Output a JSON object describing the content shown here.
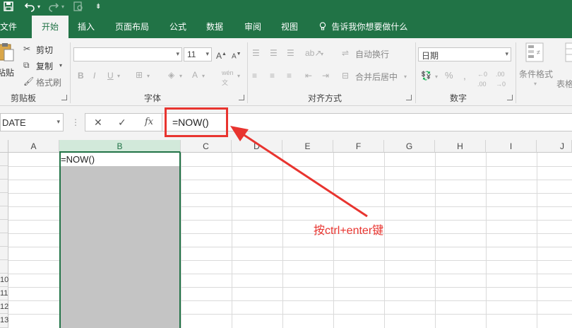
{
  "quick_access": {
    "save_icon": "save-icon",
    "undo_icon": "undo-icon",
    "redo_icon": "redo-icon"
  },
  "tabs": [
    {
      "label": "文件"
    },
    {
      "label": "开始",
      "active": true
    },
    {
      "label": "插入"
    },
    {
      "label": "页面布局"
    },
    {
      "label": "公式"
    },
    {
      "label": "数据"
    },
    {
      "label": "审阅"
    },
    {
      "label": "视图"
    }
  ],
  "tell_me": "告诉我你想要做什么",
  "ribbon": {
    "clipboard": {
      "paste": "粘贴",
      "cut": "剪切",
      "copy": "复制",
      "format_painter": "格式刷",
      "label": "剪贴板"
    },
    "font": {
      "font_name": "",
      "font_size": "11",
      "label": "字体"
    },
    "alignment": {
      "wrap_text": "自动换行",
      "merge_center": "合并后居中",
      "label": "对齐方式"
    },
    "number": {
      "format": "日期",
      "label": "数字"
    },
    "styles": {
      "conditional": "条件格式",
      "table_partial": "表格"
    }
  },
  "formula_bar": {
    "name_box": "DATE",
    "formula": "=NOW()"
  },
  "grid": {
    "columns": [
      "A",
      "B",
      "C",
      "D",
      "E",
      "F",
      "G",
      "H",
      "I",
      "J"
    ],
    "selected_column": "B",
    "rows": [
      "",
      "",
      "",
      "",
      "",
      "",
      "",
      "",
      "",
      "10",
      "11",
      "12",
      "13"
    ],
    "active_cell_value": "=NOW()"
  },
  "annotation": {
    "text": "按ctrl+enter键",
    "color": "#e8342f"
  },
  "colors": {
    "brand": "#217346",
    "highlight": "#e8342f"
  }
}
